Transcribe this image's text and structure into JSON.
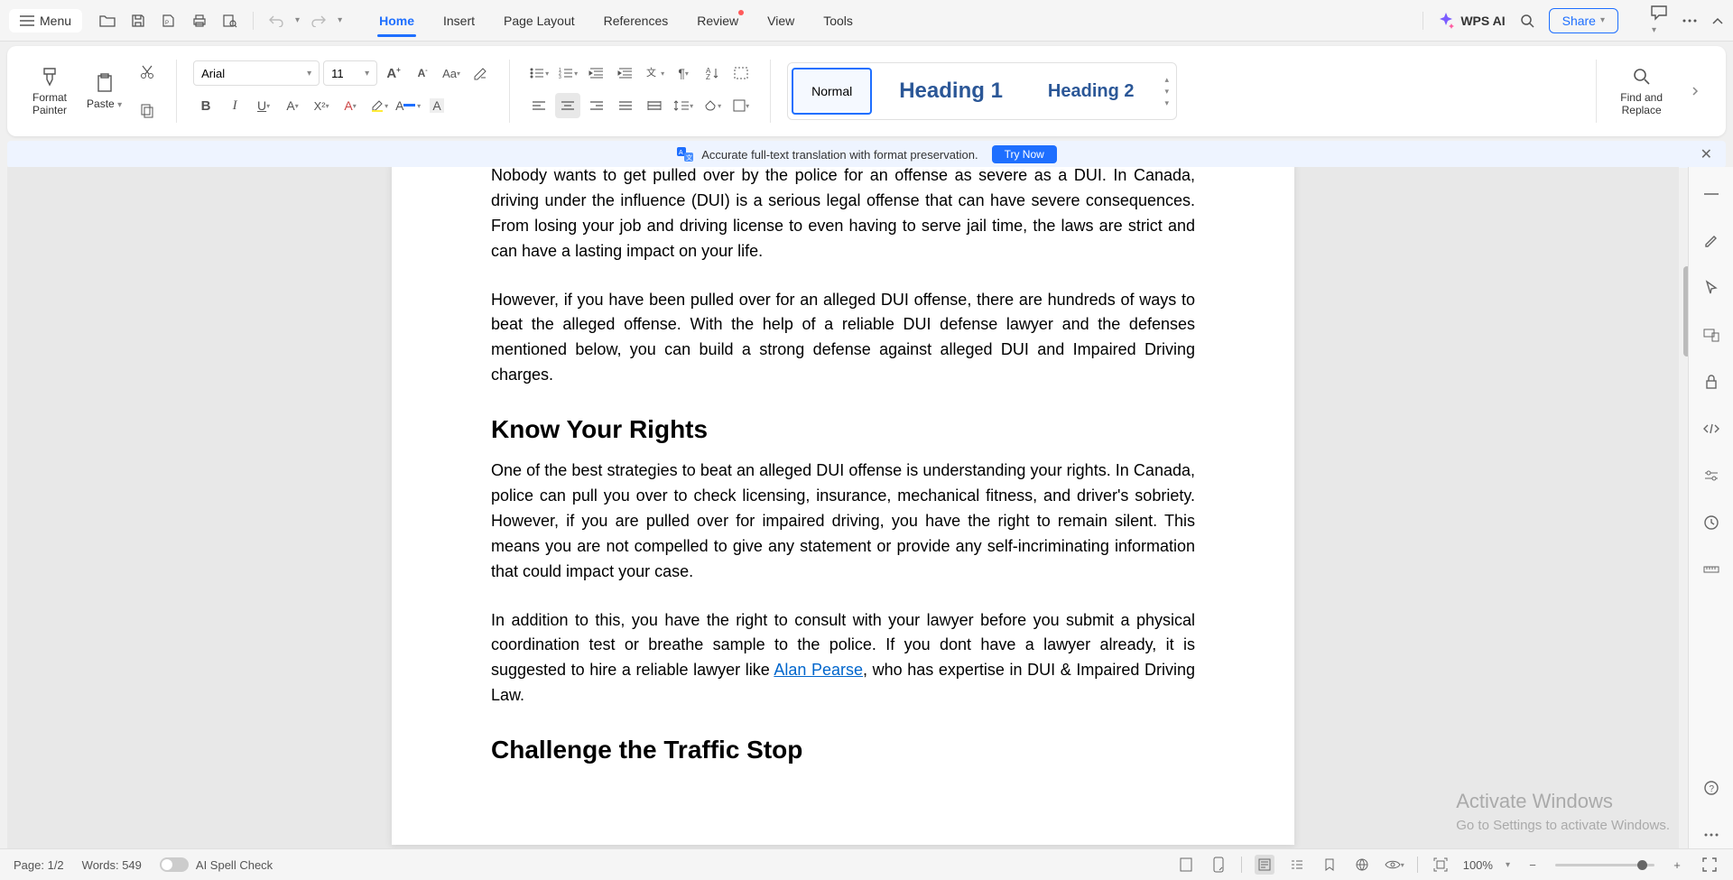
{
  "menu": {
    "label": "Menu"
  },
  "tabs": {
    "home": "Home",
    "insert": "Insert",
    "page_layout": "Page Layout",
    "references": "References",
    "review": "Review",
    "view": "View",
    "tools": "Tools"
  },
  "wps_ai": "WPS AI",
  "share": "Share",
  "ribbon": {
    "format_painter": "Format\nPainter",
    "paste": "Paste",
    "font_name": "Arial",
    "font_size": "11",
    "styles": {
      "normal": "Normal",
      "h1": "Heading 1",
      "h2": "Heading 2"
    },
    "find_replace": "Find and\nReplace"
  },
  "banner": {
    "text": "Accurate full-text translation with format preservation.",
    "button": "Try Now"
  },
  "document": {
    "p1": "Nobody wants to get pulled over by the police for an offense as severe as a DUI. In Canada, driving under the influence (DUI) is a serious legal offense that can have severe consequences. From losing your job and driving license to even having to serve jail time, the laws are strict and can have a lasting impact on your life.",
    "p2": "However, if you have been pulled over for an alleged DUI offense, there are hundreds of ways to beat the alleged offense. With the help of a reliable DUI defense lawyer and the defenses mentioned below, you can build a strong defense against alleged DUI and Impaired Driving charges.",
    "h1": "Know Your Rights",
    "p3": "One of the best strategies to beat an alleged DUI offense is understanding your rights. In Canada, police can pull you over to check licensing, insurance, mechanical fitness, and driver's sobriety. However, if you are pulled over for impaired driving, you have the right to remain silent. This means you are not compelled to give any statement or provide any self-incriminating information that could impact your case.",
    "p4a": "In addition to this, you have the right to consult with your lawyer before you submit a physical coordination test or breathe sample to the police. If you dont have a lawyer already, it is suggested to hire a reliable lawyer like ",
    "p4link": "Alan Pearse",
    "p4b": ", who has expertise in DUI & Impaired Driving Law.",
    "h2": "Challenge the Traffic Stop"
  },
  "status": {
    "page": "Page: 1/2",
    "words": "Words: 549",
    "spell": "AI Spell Check",
    "zoom": "100%"
  },
  "watermark": {
    "l1": "Activate Windows",
    "l2": "Go to Settings to activate Windows."
  }
}
